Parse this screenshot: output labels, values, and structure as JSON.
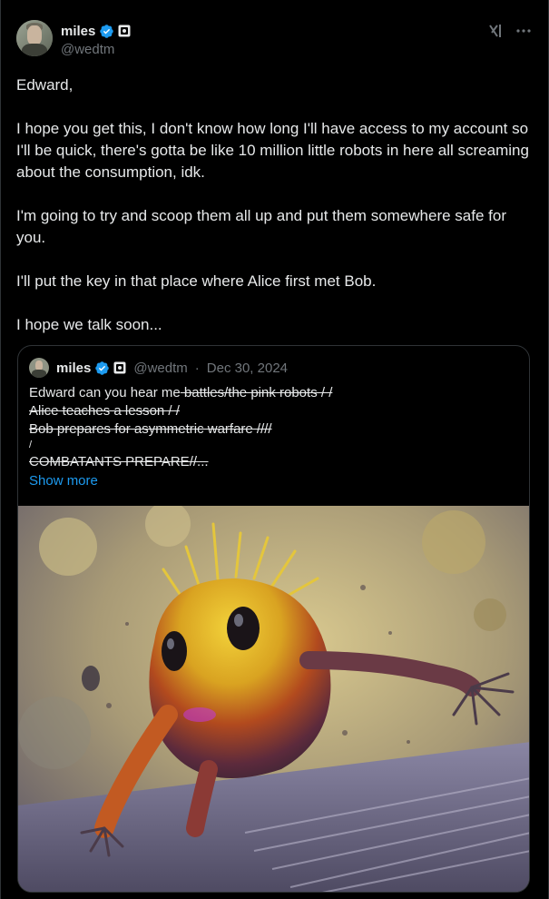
{
  "author": {
    "display_name": "miles",
    "handle": "@wedtm"
  },
  "tweet": {
    "paragraphs": [
      "Edward,",
      "I hope you get this, I don't know how long I'll have access to my account so I'll be quick, there's gotta be like 10 million little robots in here all screaming about the consumption, idk.",
      "I'm going to try and scoop them all up and put them somewhere safe for you.",
      "I'll put the key in that place where Alice first met Bob.",
      "I hope we talk soon..."
    ]
  },
  "quoted_tweet": {
    "display_name": "miles",
    "handle": "@wedtm",
    "separator": "·",
    "date": "Dec 30, 2024",
    "lines": {
      "l1_plain": "Edward can you hear me",
      "l1_strike": " battles/the pink robots / /",
      "l2": "Alice teaches a lesson / /",
      "l3": "Bob prepares for asymmetric warfare ////",
      "l4": "/",
      "l5": "COMBATANTS PREPARE//..."
    },
    "show_more_label": "Show more"
  },
  "icons": {
    "verified": "verified-badge-icon",
    "org": "affiliate-badge-icon",
    "grok": "grok-icon",
    "more": "more-options-icon"
  },
  "colors": {
    "background": "#000000",
    "text": "#e7e9ea",
    "muted": "#71767b",
    "link": "#1d9bf0",
    "border": "#2f3336"
  }
}
